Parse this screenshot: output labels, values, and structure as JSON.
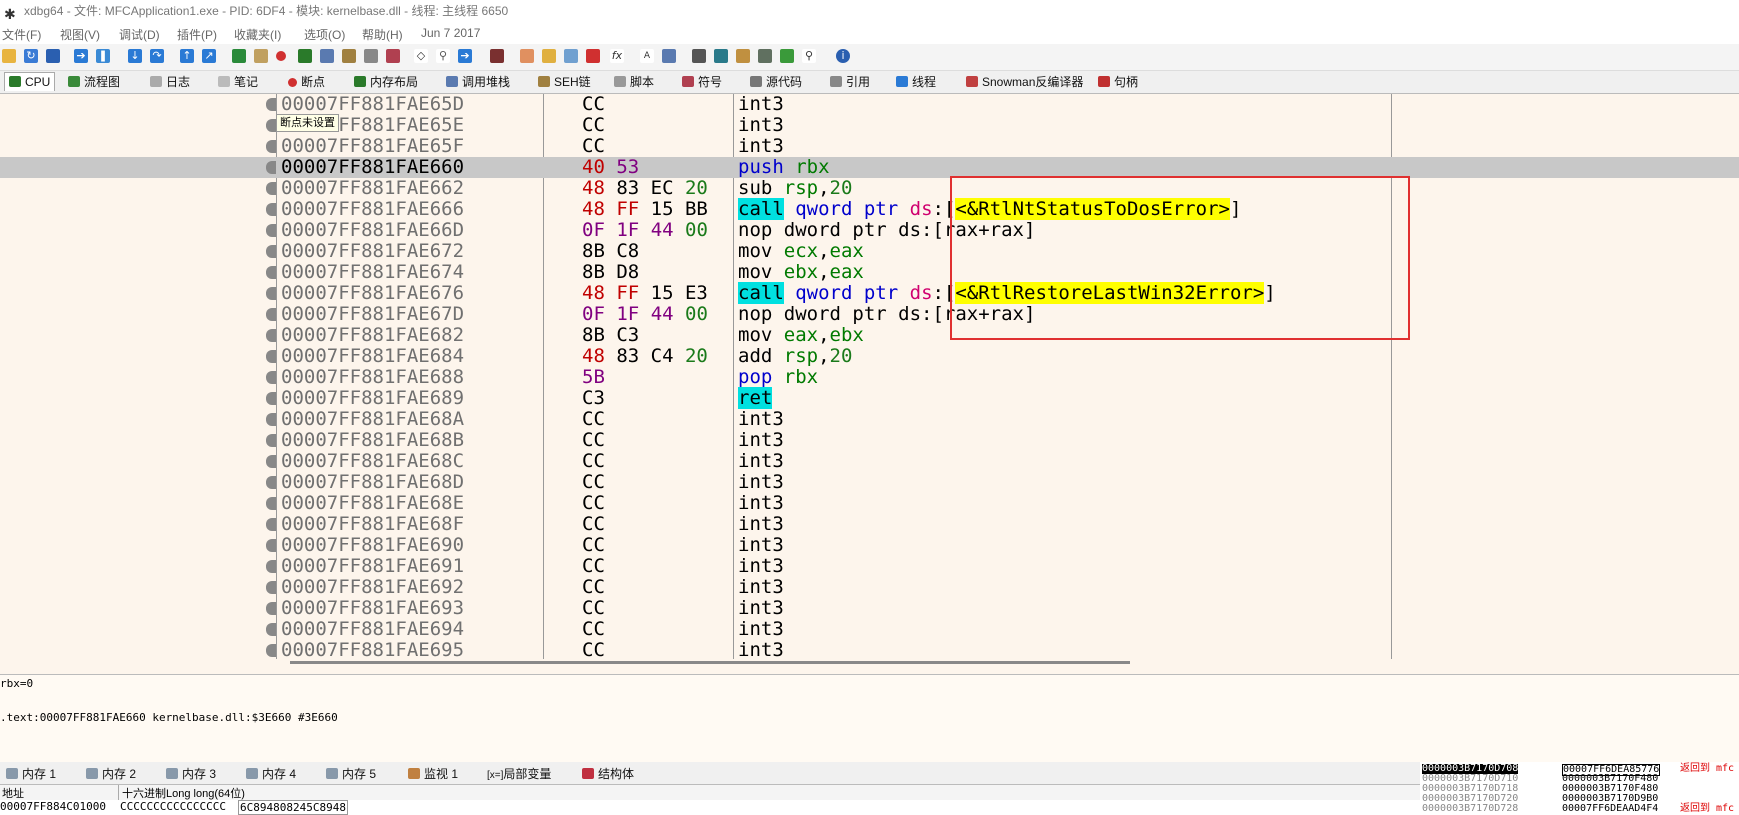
{
  "window": {
    "title": "xdbg64 - 文件: MFCApplication1.exe - PID: 6DF4 - 模块: kernelbase.dll - 线程: 主线程 6650"
  },
  "menu": {
    "items": [
      "文件(F)",
      "视图(V)",
      "调试(D)",
      "插件(P)",
      "收藏夹(I)",
      "选项(O)",
      "帮助(H)"
    ],
    "date": "Jun 7 2017"
  },
  "tabs": [
    {
      "label": "CPU",
      "icon": "cpu-icon"
    },
    {
      "label": "流程图",
      "icon": "graph-icon"
    },
    {
      "label": "日志",
      "icon": "log-icon"
    },
    {
      "label": "笔记",
      "icon": "notes-icon"
    },
    {
      "label": "断点",
      "icon": "breakpoint-icon"
    },
    {
      "label": "内存布局",
      "icon": "memory-map-icon"
    },
    {
      "label": "调用堆栈",
      "icon": "callstack-icon"
    },
    {
      "label": "SEH链",
      "icon": "seh-icon"
    },
    {
      "label": "脚本",
      "icon": "script-icon"
    },
    {
      "label": "符号",
      "icon": "symbols-icon"
    },
    {
      "label": "源代码",
      "icon": "source-icon"
    },
    {
      "label": "引用",
      "icon": "references-icon"
    },
    {
      "label": "线程",
      "icon": "threads-icon"
    },
    {
      "label": "Snowman反编译器",
      "icon": "snowman-icon"
    },
    {
      "label": "句柄",
      "icon": "handles-icon"
    }
  ],
  "disasm": {
    "tooltip": "断点未设置",
    "rows": [
      {
        "addr": "00007FF881FAE65D",
        "bytes": "CC",
        "ins": "int3"
      },
      {
        "addr": "00007FF881FAE65E",
        "bytes": "CC",
        "ins": "int3"
      },
      {
        "addr": "00007FF881FAE65F",
        "bytes": "CC",
        "ins": "int3"
      },
      {
        "addr": "00007FF881FAE660",
        "bytes": "40 53",
        "ins": "push rbx"
      },
      {
        "addr": "00007FF881FAE662",
        "bytes": "48 83 EC 20",
        "ins": "sub rsp,20"
      },
      {
        "addr": "00007FF881FAE666",
        "bytes": "48 FF 15 BB",
        "ins": "call qword ptr ds:[<&RtlNtStatusToDosError>]"
      },
      {
        "addr": "00007FF881FAE66D",
        "bytes": "0F 1F 44 00",
        "ins": "nop dword ptr ds:[rax+rax]"
      },
      {
        "addr": "00007FF881FAE672",
        "bytes": "8B C8",
        "ins": "mov ecx,eax"
      },
      {
        "addr": "00007FF881FAE674",
        "bytes": "8B D8",
        "ins": "mov ebx,eax"
      },
      {
        "addr": "00007FF881FAE676",
        "bytes": "48 FF 15 E3",
        "ins": "call qword ptr ds:[<&RtlRestoreLastWin32Error>]"
      },
      {
        "addr": "00007FF881FAE67D",
        "bytes": "0F 1F 44 00",
        "ins": "nop dword ptr ds:[rax+rax]"
      },
      {
        "addr": "00007FF881FAE682",
        "bytes": "8B C3",
        "ins": "mov eax,ebx"
      },
      {
        "addr": "00007FF881FAE684",
        "bytes": "48 83 C4 20",
        "ins": "add rsp,20"
      },
      {
        "addr": "00007FF881FAE688",
        "bytes": "5B",
        "ins": "pop rbx"
      },
      {
        "addr": "00007FF881FAE689",
        "bytes": "C3",
        "ins": "ret"
      },
      {
        "addr": "00007FF881FAE68A",
        "bytes": "CC",
        "ins": "int3"
      },
      {
        "addr": "00007FF881FAE68B",
        "bytes": "CC",
        "ins": "int3"
      },
      {
        "addr": "00007FF881FAE68C",
        "bytes": "CC",
        "ins": "int3"
      },
      {
        "addr": "00007FF881FAE68D",
        "bytes": "CC",
        "ins": "int3"
      },
      {
        "addr": "00007FF881FAE68E",
        "bytes": "CC",
        "ins": "int3"
      },
      {
        "addr": "00007FF881FAE68F",
        "bytes": "CC",
        "ins": "int3"
      },
      {
        "addr": "00007FF881FAE690",
        "bytes": "CC",
        "ins": "int3"
      },
      {
        "addr": "00007FF881FAE691",
        "bytes": "CC",
        "ins": "int3"
      },
      {
        "addr": "00007FF881FAE692",
        "bytes": "CC",
        "ins": "int3"
      },
      {
        "addr": "00007FF881FAE693",
        "bytes": "CC",
        "ins": "int3"
      },
      {
        "addr": "00007FF881FAE694",
        "bytes": "CC",
        "ins": "int3"
      },
      {
        "addr": "00007FF881FAE695",
        "bytes": "CC",
        "ins": "int3"
      }
    ]
  },
  "info": {
    "line1": "rbx=0",
    "line2": ".text:00007FF881FAE660 kernelbase.dll:$3E660 #3E660"
  },
  "bottom_tabs": [
    "内存 1",
    "内存 2",
    "内存 3",
    "内存 4",
    "内存 5",
    "监视 1",
    "局部变量",
    "结构体"
  ],
  "bottom_tab_prefix": "[x=]",
  "memory": {
    "col_addr": "地址",
    "col_hex": "十六进制Long long(64位)",
    "row_addr": "00007FF884C01000",
    "row_v1": "CCCCCCCCCCCCCCCC",
    "row_v2": "6C894808245C8948"
  },
  "stack": {
    "left": [
      "0000003B7170D708",
      "0000003B7170D710",
      "0000003B7170D718",
      "0000003B7170D720",
      "0000003B7170D728"
    ],
    "right": [
      "00007FF6DEA85776",
      "0000003B7170F480",
      "0000003B7170F480",
      "0000003B7170D9B0",
      "00007FF6DEAAD4F4"
    ],
    "comments": [
      "返回到 mfc",
      "",
      "",
      "",
      "返回到 mfc"
    ]
  },
  "colors": {
    "highlight_box": "#e03030",
    "call_bg": "#00e0e0",
    "symbol_bg": "#ffff00"
  }
}
